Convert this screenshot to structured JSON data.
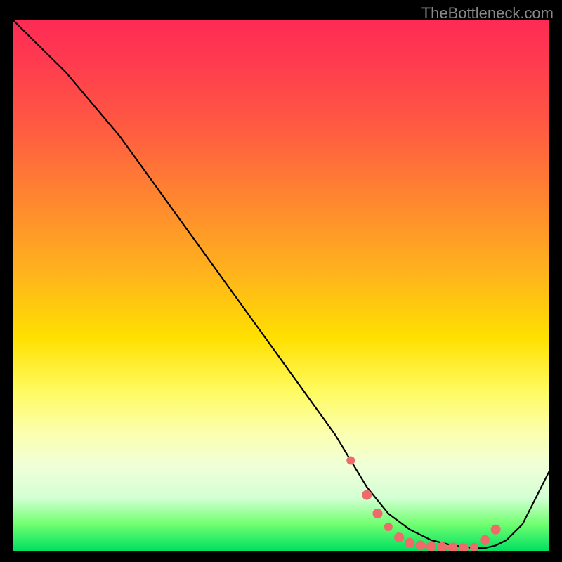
{
  "watermark": "TheBottleneck.com",
  "chart_data": {
    "type": "line",
    "title": "",
    "xlabel": "",
    "ylabel": "",
    "xlim": [
      0,
      100
    ],
    "ylim": [
      0,
      100
    ],
    "series": [
      {
        "name": "bottleneck-curve",
        "x": [
          0,
          6,
          10,
          15,
          20,
          25,
          30,
          35,
          40,
          45,
          50,
          55,
          60,
          63,
          66,
          70,
          74,
          78,
          82,
          86,
          88,
          90,
          92,
          95,
          100
        ],
        "values": [
          100,
          94,
          90,
          84,
          78,
          71,
          64,
          57,
          50,
          43,
          36,
          29,
          22,
          17,
          12,
          7,
          4,
          2,
          1,
          0.5,
          0.5,
          1,
          2,
          5,
          15
        ]
      }
    ],
    "markers": {
      "name": "highlighted-points",
      "color": "#ef6a6a",
      "points": [
        {
          "x": 63,
          "y": 17,
          "size": 6
        },
        {
          "x": 66,
          "y": 10.5,
          "size": 7
        },
        {
          "x": 68,
          "y": 7,
          "size": 7
        },
        {
          "x": 70,
          "y": 4.5,
          "size": 6
        },
        {
          "x": 72,
          "y": 2.5,
          "size": 7
        },
        {
          "x": 74,
          "y": 1.5,
          "size": 7
        },
        {
          "x": 76,
          "y": 1,
          "size": 7
        },
        {
          "x": 78,
          "y": 0.8,
          "size": 7
        },
        {
          "x": 80,
          "y": 0.7,
          "size": 7
        },
        {
          "x": 82,
          "y": 0.6,
          "size": 7
        },
        {
          "x": 84,
          "y": 0.5,
          "size": 7
        },
        {
          "x": 86,
          "y": 0.7,
          "size": 6
        },
        {
          "x": 88,
          "y": 2,
          "size": 7
        },
        {
          "x": 90,
          "y": 4,
          "size": 7
        }
      ]
    },
    "gradient_stops": [
      {
        "pos": 0,
        "color": "#ff2a55"
      },
      {
        "pos": 50,
        "color": "#ffd000"
      },
      {
        "pos": 80,
        "color": "#fffb80"
      },
      {
        "pos": 100,
        "color": "#00e060"
      }
    ]
  }
}
